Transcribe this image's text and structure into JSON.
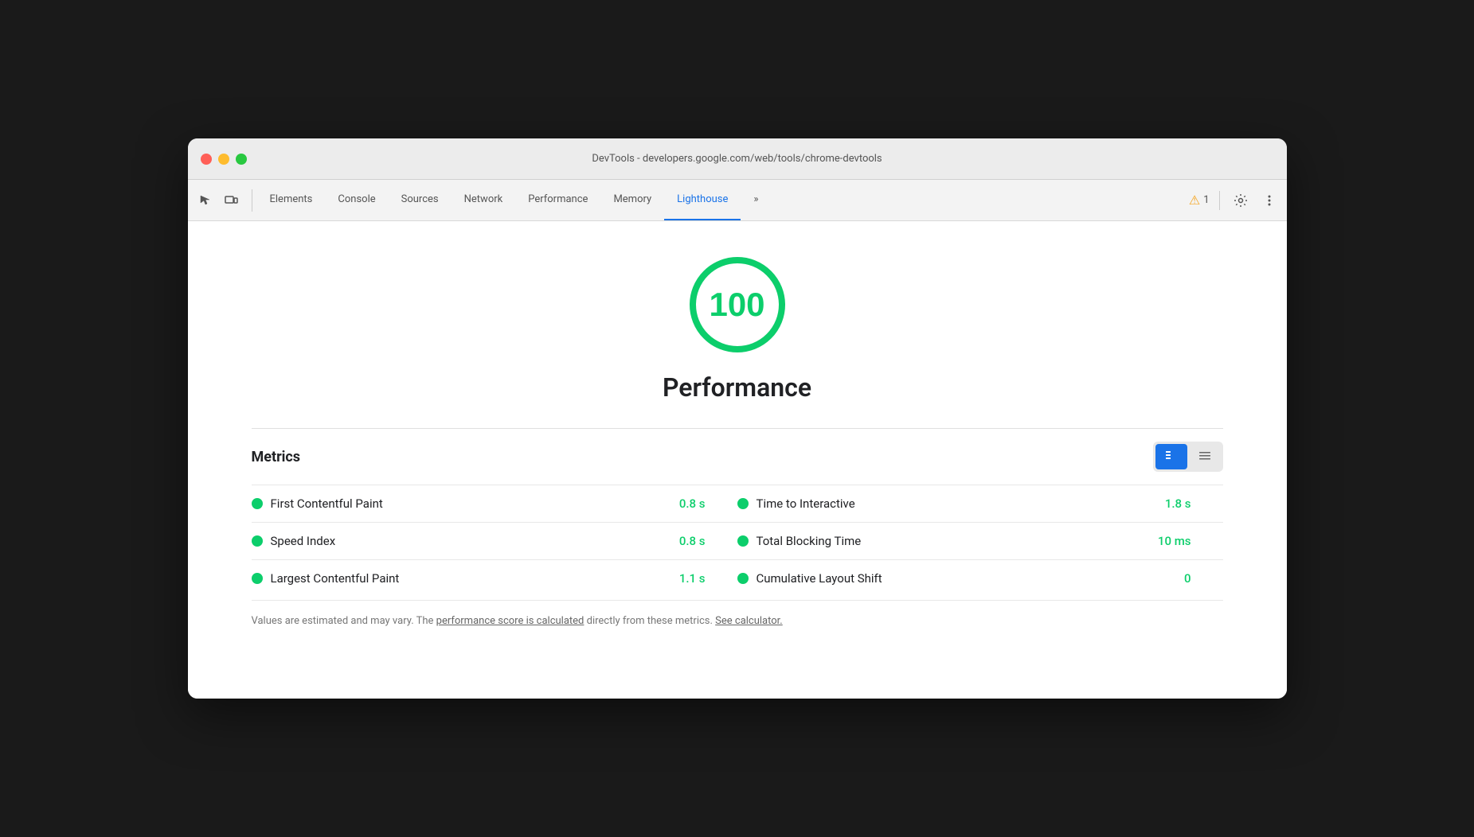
{
  "window": {
    "title": "DevTools - developers.google.com/web/tools/chrome-devtools"
  },
  "tabs": [
    {
      "id": "elements",
      "label": "Elements",
      "active": false
    },
    {
      "id": "console",
      "label": "Console",
      "active": false
    },
    {
      "id": "sources",
      "label": "Sources",
      "active": false
    },
    {
      "id": "network",
      "label": "Network",
      "active": false
    },
    {
      "id": "performance",
      "label": "Performance",
      "active": false
    },
    {
      "id": "memory",
      "label": "Memory",
      "active": false
    },
    {
      "id": "lighthouse",
      "label": "Lighthouse",
      "active": true
    }
  ],
  "toolbar": {
    "warning_count": "1",
    "more_tabs_label": "»"
  },
  "lighthouse": {
    "score": "100",
    "score_label": "Performance",
    "metrics_title": "Metrics",
    "metrics": [
      {
        "name": "First Contentful Paint",
        "value": "0.8 s",
        "dot_color": "#0cce6b"
      },
      {
        "name": "Speed Index",
        "value": "0.8 s",
        "dot_color": "#0cce6b"
      },
      {
        "name": "Largest Contentful Paint",
        "value": "1.1 s",
        "dot_color": "#0cce6b"
      },
      {
        "name": "Time to Interactive",
        "value": "1.8 s",
        "dot_color": "#0cce6b"
      },
      {
        "name": "Total Blocking Time",
        "value": "10 ms",
        "dot_color": "#0cce6b"
      },
      {
        "name": "Cumulative Layout Shift",
        "value": "0",
        "dot_color": "#0cce6b"
      }
    ],
    "footer_text_1": "Values are estimated and may vary. The ",
    "footer_link_1": "performance score is calculated",
    "footer_text_2": " directly from these metrics. ",
    "footer_link_2": "See calculator.",
    "toggle_grid_label": "≡",
    "toggle_list_label": "☰"
  }
}
